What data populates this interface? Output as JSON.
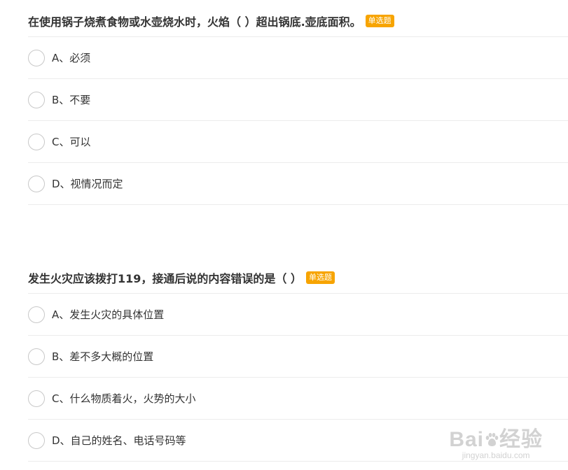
{
  "questions": [
    {
      "title": "在使用锅子烧煮食物或水壶烧水时，火焰（   ）超出锅底.壶底面积。",
      "badge": "单选题",
      "options": [
        {
          "text": "A、必须"
        },
        {
          "text": "B、不要"
        },
        {
          "text": "C、可以"
        },
        {
          "text": "D、视情况而定"
        }
      ]
    },
    {
      "title": "发生火灾应该拨打119，接通后说的内容错误的是（   ）",
      "badge": "单选题",
      "options": [
        {
          "text": "A、发生火灾的具体位置"
        },
        {
          "text": "B、差不多大概的位置"
        },
        {
          "text": "C、什么物质着火，火势的大小"
        },
        {
          "text": "D、自己的姓名、电话号码等"
        }
      ]
    }
  ],
  "watermark": {
    "logo": "Bai",
    "logo_suffix": "经验",
    "url": "jingyan.baidu.com",
    "icon": "paw-icon"
  },
  "colors": {
    "badge": "#f7a400",
    "title_text": "#333333",
    "divider": "#ececec",
    "radio_border": "#c8c8c8",
    "watermark": "#d2d2d2"
  }
}
